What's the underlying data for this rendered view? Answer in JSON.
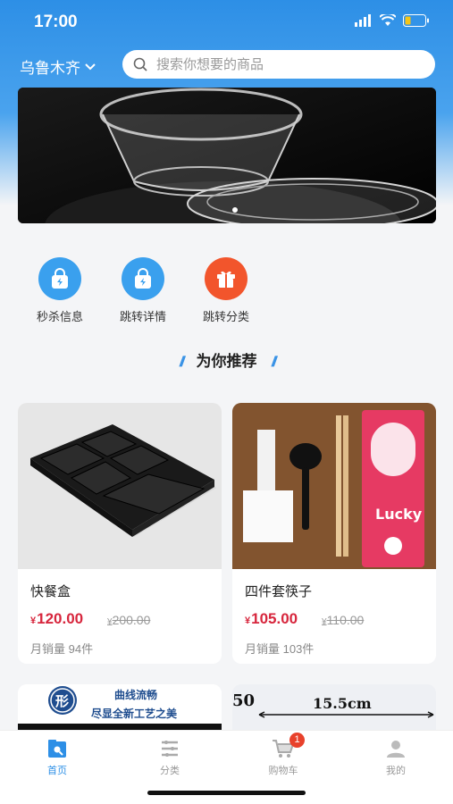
{
  "status_bar": {
    "time": "17:00"
  },
  "header": {
    "city": "乌鲁木齐",
    "search_placeholder": "搜索你想要的商品"
  },
  "quick_actions": [
    {
      "label": "秒杀信息",
      "icon": "shopping-bag-flash-icon",
      "color": "#3aa0ee"
    },
    {
      "label": "跳转详情",
      "icon": "shopping-bag-flash-icon",
      "color": "#3aa0ee"
    },
    {
      "label": "跳转分类",
      "icon": "gift-icon",
      "color": "#f2552c"
    }
  ],
  "section": {
    "title": "为你推荐"
  },
  "products": [
    {
      "name": "快餐盒",
      "currency": "¥",
      "price": "120.00",
      "original_price": "200.00",
      "sales": "月销量 94件"
    },
    {
      "name": "四件套筷子",
      "currency": "¥",
      "price": "105.00",
      "original_price": "110.00",
      "sales": "月销量 103件"
    }
  ],
  "peek_cards": [
    {
      "line1": "曲线流畅",
      "line2": "尽显全新工艺之美",
      "seal": "形"
    },
    {
      "left_num": "50",
      "measure": "15.5cm"
    }
  ],
  "tabbar": {
    "items": [
      {
        "label": "首页",
        "icon": "home-icon",
        "active": true
      },
      {
        "label": "分类",
        "icon": "category-list-icon",
        "active": false
      },
      {
        "label": "购物车",
        "icon": "cart-icon",
        "active": false,
        "badge": "1"
      },
      {
        "label": "我的",
        "icon": "profile-icon",
        "active": false
      }
    ]
  },
  "colors": {
    "primary": "#2d8fe6",
    "price": "#d7263d",
    "gift": "#f2552c"
  }
}
